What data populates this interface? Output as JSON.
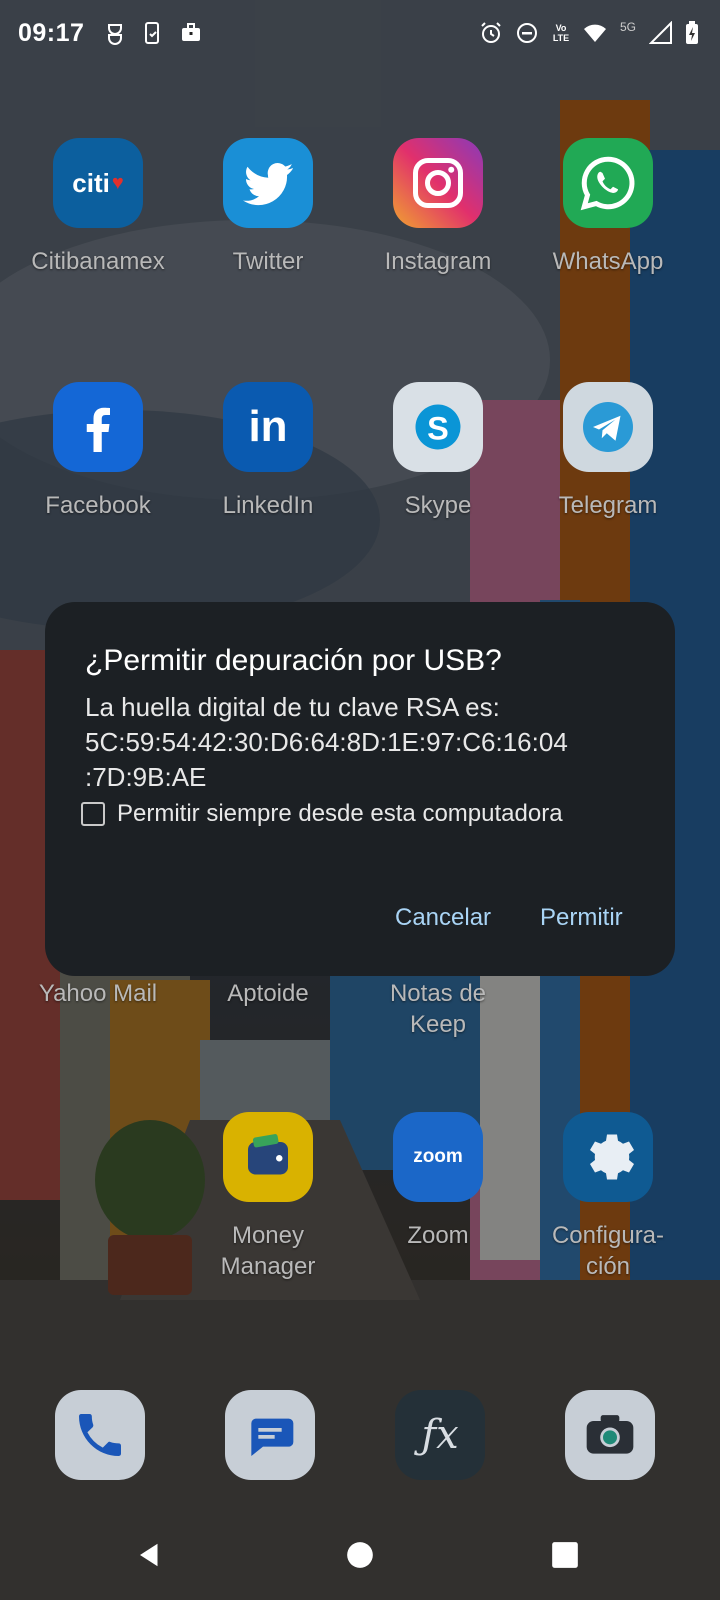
{
  "status_bar": {
    "time": "09:17",
    "network": "5G",
    "volte": "Vo LTE",
    "left_icons": [
      "mask-icon",
      "phone-sync-icon",
      "briefcase-icon"
    ],
    "right_icons": [
      "alarm-icon",
      "dnd-icon",
      "volte-icon",
      "wifi-icon",
      "signal-icon",
      "battery-icon"
    ]
  },
  "home": {
    "row1": [
      {
        "label": "Citibanamex",
        "icon": "citibanamex-icon",
        "color": "#0e6fb8"
      },
      {
        "label": "Twitter",
        "icon": "twitter-icon",
        "color": "#1da1f2"
      },
      {
        "label": "Instagram",
        "icon": "instagram-icon",
        "color": "#c13584"
      },
      {
        "label": "WhatsApp",
        "icon": "whatsapp-icon",
        "color": "#25d366"
      }
    ],
    "row2": [
      {
        "label": "Facebook",
        "icon": "facebook-icon",
        "color": "#1877f2"
      },
      {
        "label": "LinkedIn",
        "icon": "linkedin-icon",
        "color": "#0a66c2"
      },
      {
        "label": "Skype",
        "icon": "skype-icon",
        "color": "#00aff0"
      },
      {
        "label": "Telegram",
        "icon": "telegram-icon",
        "color": "#2aa3de"
      }
    ],
    "row3": [
      {
        "label": "Yahoo Mail",
        "icon": "yahoo-mail-icon"
      },
      {
        "label": "Aptoide",
        "icon": "aptoide-icon"
      },
      {
        "label": "Notas de Keep",
        "icon": "keep-icon"
      }
    ],
    "row4": [
      {
        "label": "Money Manager",
        "icon": "money-manager-icon",
        "color": "#f5c400"
      },
      {
        "label": "Zoom",
        "icon": "zoom-icon",
        "color": "#2d8cff"
      },
      {
        "label": "Configura-ción",
        "icon": "settings-icon",
        "color": "#1a73c9"
      }
    ],
    "row4_label_lines": {
      "money": [
        "Money",
        "Manager"
      ],
      "config": [
        "Configura-",
        "ción"
      ],
      "keep": [
        "Notas de",
        "Keep"
      ]
    },
    "zoom_icon_text": "zoom",
    "citi_icon_text": "citi",
    "dock": [
      "phone-icon",
      "messages-icon",
      "fx-file-explorer-icon",
      "camera-icon"
    ]
  },
  "dialog": {
    "title": "¿Permitir depuración por USB?",
    "body_line1": "La huella digital de tu clave RSA es:",
    "body_line2": "5C:59:54:42:30:D6:64:8D:1E:97:C6:16:04",
    "body_line3": ":7D:9B:AE",
    "checkbox_label": "Permitir siempre desde esta computadora",
    "checkbox_checked": false,
    "cancel_label": "Cancelar",
    "allow_label": "Permitir",
    "button_color": "#a9d4f5"
  },
  "navbar": {
    "buttons": [
      "back-icon",
      "home-icon",
      "recents-icon"
    ]
  }
}
